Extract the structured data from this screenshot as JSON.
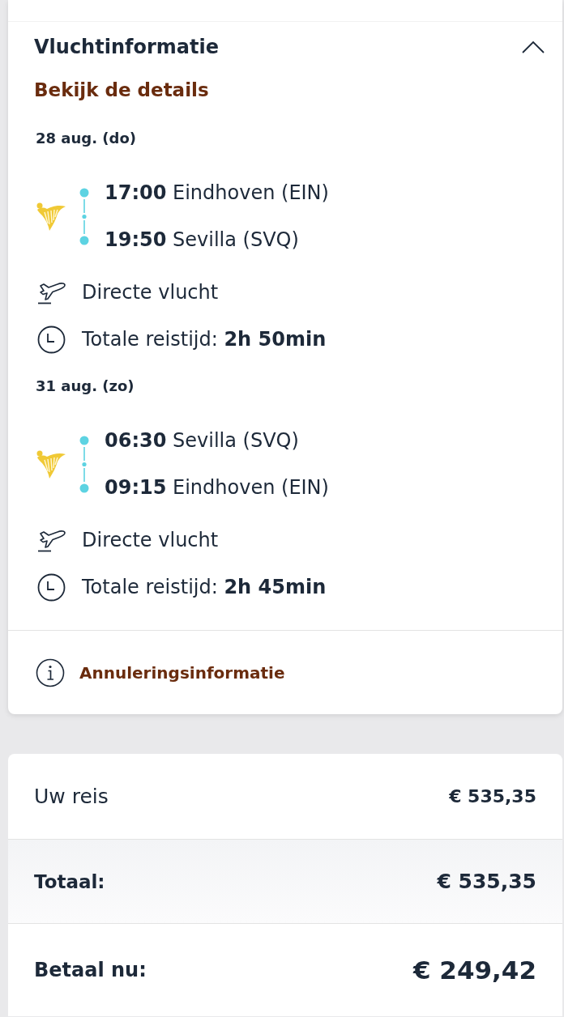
{
  "flight_info": {
    "title": "Vluchtinformatie",
    "expanded": true,
    "details_link": "Bekijk de details",
    "legs": [
      {
        "date": "28 aug. (do)",
        "departure": "**17:00** Eindhoven (EIN)",
        "arrival": "**19:50** Sevilla (SVQ)",
        "flight_type": "Directe vlucht",
        "duration": "Totale reistijd: **2h 50min**"
      },
      {
        "date": "31 aug. (zo)",
        "departure": "**06:30** Sevilla (SVQ)",
        "arrival": "**09:15** Eindhoven (EIN)",
        "flight_type": "Directe vlucht",
        "duration": "Totale reistijd: **2h 45min**"
      }
    ],
    "cancellation_link": "Annuleringsinformatie"
  },
  "price_summary": {
    "rows": [
      {
        "kind": "item",
        "label": "Uw reis",
        "amount": "€ 535,35"
      },
      {
        "kind": "total",
        "label": "Totaal:",
        "amount": "€ 535,35"
      },
      {
        "kind": "due",
        "label": "Betaal nu:",
        "amount": "€ 249,42"
      }
    ]
  }
}
